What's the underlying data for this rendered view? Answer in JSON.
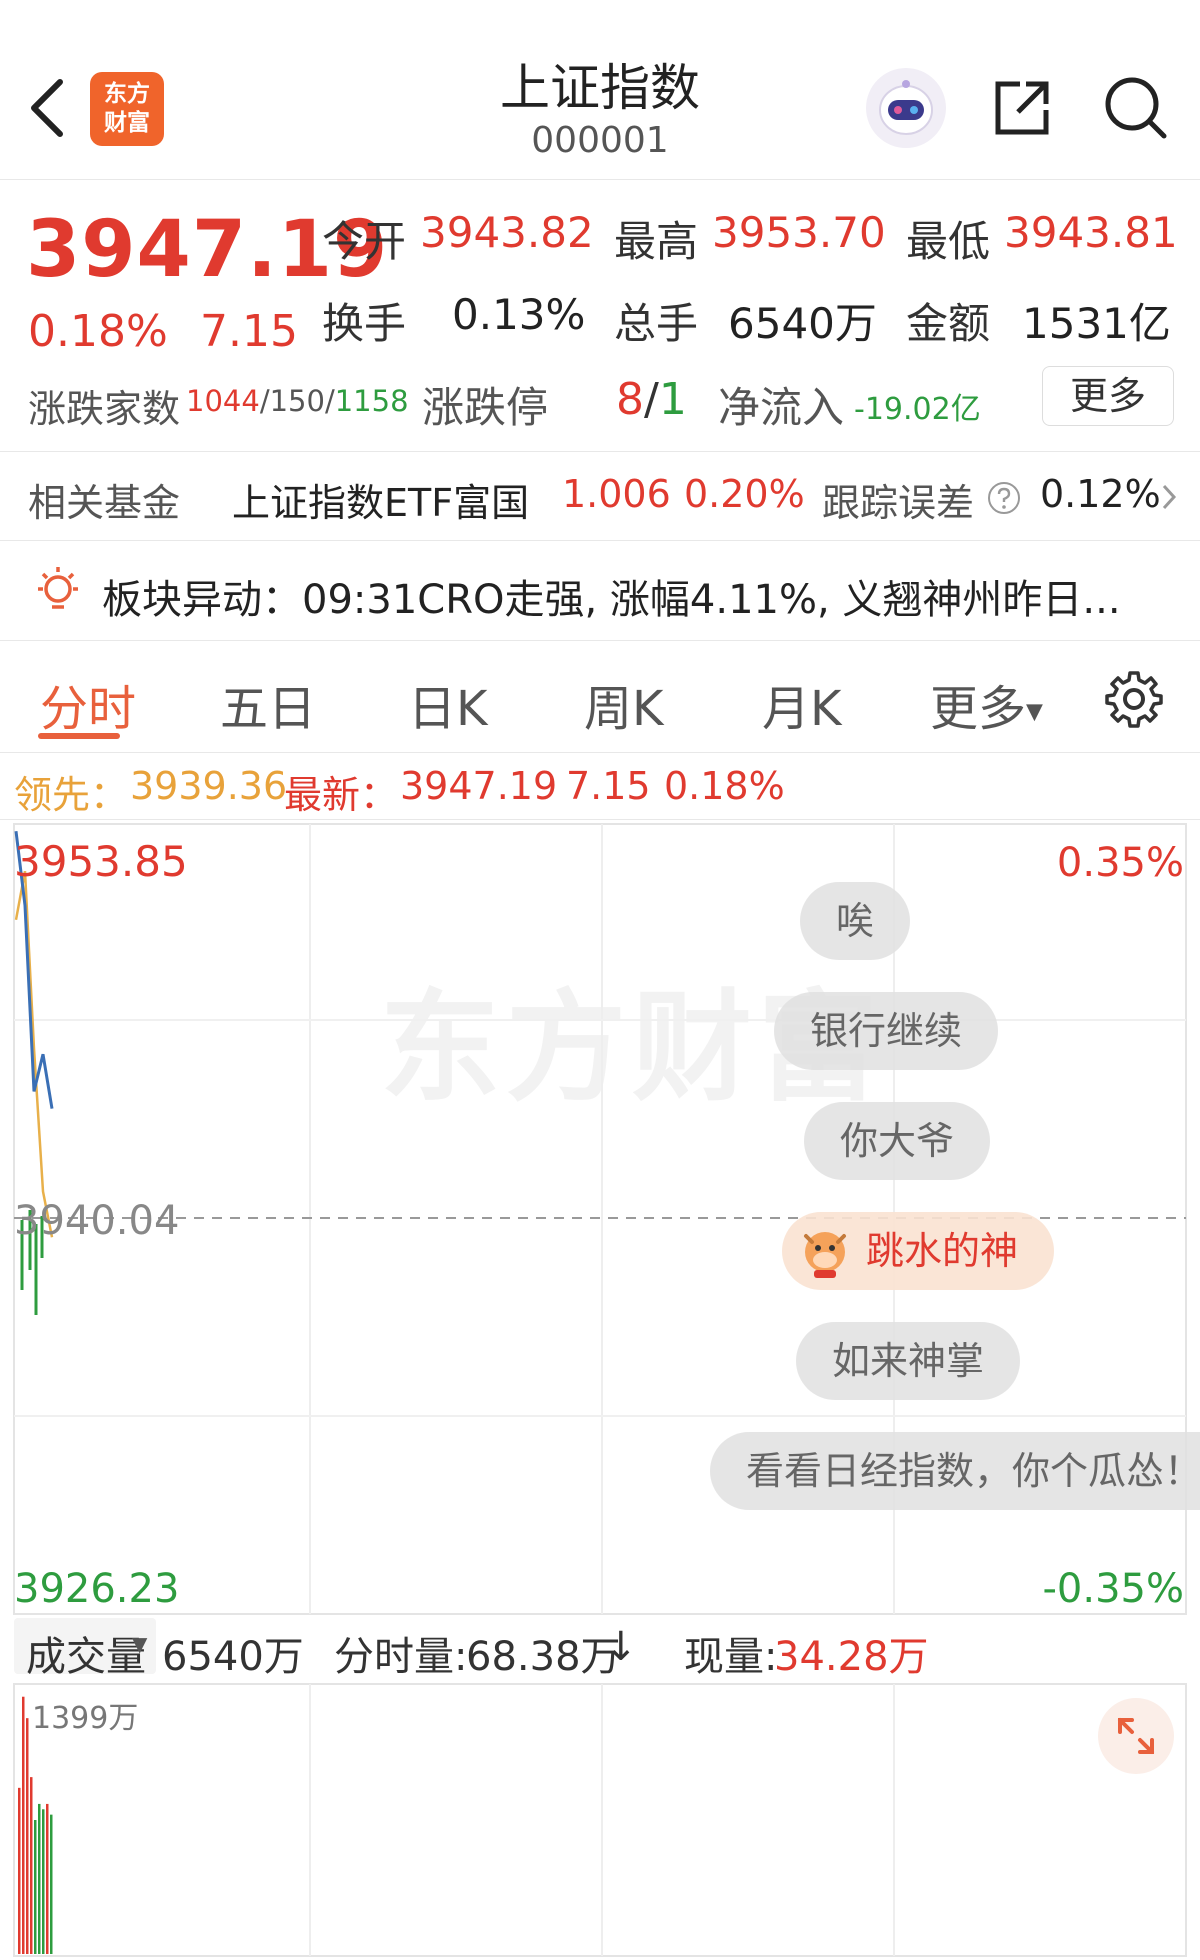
{
  "header": {
    "logo_line1": "东方",
    "logo_line2": "财富",
    "title": "上证指数",
    "code": "000001"
  },
  "quote": {
    "price": "3947.19",
    "change_pct": "0.18%",
    "change": "7.15",
    "open_label": "今开",
    "open": "3943.82",
    "high_label": "最高",
    "high": "3953.70",
    "low_label": "最低",
    "low": "3943.81",
    "turnover_label": "换手",
    "turnover": "0.13%",
    "volume_label": "总手",
    "volume": "6540万",
    "amount_label": "金额",
    "amount": "1531亿",
    "breadth_label": "涨跌家数",
    "up_count": "1044",
    "flat_count": "150",
    "down_count": "1158",
    "sep": "/",
    "limit_label": "涨跌停",
    "limit_up": "8",
    "limit_down": "1",
    "inflow_label": "净流入",
    "inflow": "-19.02亿",
    "more_label": "更多"
  },
  "fund": {
    "label": "相关基金",
    "name": "上证指数ETF富国",
    "price": "1.006",
    "pct": "0.20%",
    "tracking_label": "跟踪误差",
    "tracking": "0.12%"
  },
  "alert": {
    "text": "板块异动：09:31CRO走强, 涨幅4.11%, 义翘神州昨日..."
  },
  "tabs": [
    {
      "label": "分时"
    },
    {
      "label": "五日"
    },
    {
      "label": "日K"
    },
    {
      "label": "周K"
    },
    {
      "label": "月K"
    },
    {
      "label": "更多"
    }
  ],
  "info": {
    "lead_label": "领先：",
    "lead": "3939.36",
    "latest_label": "最新：",
    "latest": "3947.19",
    "change": "7.15",
    "pct": "0.18%"
  },
  "chart": {
    "top_price": "3953.85",
    "top_pct": "0.35%",
    "mid_price": "3940.04",
    "bottom_price": "3926.23",
    "bottom_pct": "-0.35%",
    "watermark": "东方财富",
    "bubbles": [
      {
        "text": "唉"
      },
      {
        "text": "银行继续"
      },
      {
        "text": "你大爷"
      },
      {
        "text": "跳水的神"
      },
      {
        "text": "如来神掌"
      },
      {
        "text": "看看日经指数，你个瓜怂！"
      }
    ]
  },
  "volume": {
    "selector": "成交量",
    "total": "6540万",
    "minute_label": "分时量:",
    "minute": "68.38万",
    "current_label": "现量:",
    "current": "34.28万",
    "max_label": "1399万"
  },
  "colors": {
    "up": "#e03a2f",
    "down": "#2e9c3f",
    "accent": "#e8603c",
    "price_line": "#3a6fb5",
    "avg_line": "#e8b04a"
  },
  "chart_data": {
    "type": "line",
    "series": [
      {
        "values": [
          3953.6,
          3951.0,
          3944.5,
          3945.8,
          3943.9
        ]
      },
      {
        "values": [
          3950.5,
          3952.2,
          3946.0,
          3941.0,
          3939.4
        ]
      }
    ],
    "ylim": [
      3926.23,
      3953.85
    ]
  }
}
